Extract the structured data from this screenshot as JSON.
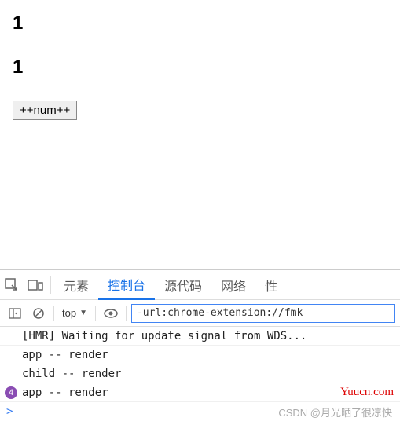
{
  "page": {
    "value1": "1",
    "value2": "1",
    "button_label": "++num++"
  },
  "devtools": {
    "tabs": {
      "elements": "元素",
      "console": "控制台",
      "sources": "源代码",
      "network": "网络",
      "performance_partial": "性"
    },
    "toolbar": {
      "context": "top",
      "filter": "-url:chrome-extension://fmk"
    },
    "logs": [
      {
        "text": "[HMR] Waiting for update signal from WDS..."
      },
      {
        "text": "app -- render"
      },
      {
        "text": "child -- render"
      },
      {
        "text": "app -- render",
        "count": "4"
      }
    ],
    "prompt": ">"
  },
  "watermark": "Yuucn.com",
  "attribution": "CSDN @月光晒了很凉快"
}
